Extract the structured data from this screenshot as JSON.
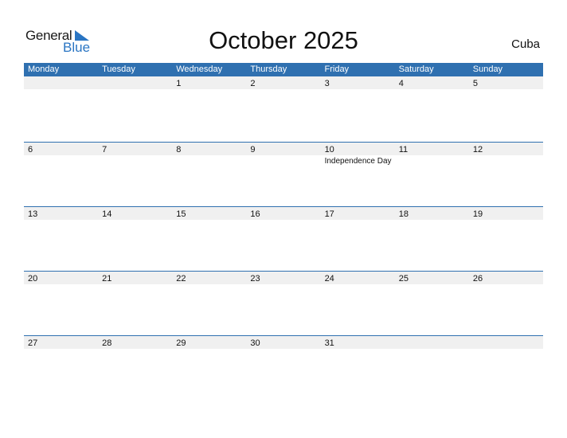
{
  "logo": {
    "word1": "General",
    "word2": "Blue"
  },
  "title": "October 2025",
  "country": "Cuba",
  "colors": {
    "header_bg": "#2f70b0",
    "accent": "#2a75c3",
    "strip_bg": "#f0f0f0"
  },
  "weekdays": [
    "Monday",
    "Tuesday",
    "Wednesday",
    "Thursday",
    "Friday",
    "Saturday",
    "Sunday"
  ],
  "weeks": [
    {
      "days": [
        {
          "n": ""
        },
        {
          "n": ""
        },
        {
          "n": "1"
        },
        {
          "n": "2"
        },
        {
          "n": "3"
        },
        {
          "n": "4"
        },
        {
          "n": "5"
        }
      ]
    },
    {
      "days": [
        {
          "n": "6"
        },
        {
          "n": "7"
        },
        {
          "n": "8"
        },
        {
          "n": "9"
        },
        {
          "n": "10",
          "holiday": "Independence Day"
        },
        {
          "n": "11"
        },
        {
          "n": "12"
        }
      ]
    },
    {
      "days": [
        {
          "n": "13"
        },
        {
          "n": "14"
        },
        {
          "n": "15"
        },
        {
          "n": "16"
        },
        {
          "n": "17"
        },
        {
          "n": "18"
        },
        {
          "n": "19"
        }
      ]
    },
    {
      "days": [
        {
          "n": "20"
        },
        {
          "n": "21"
        },
        {
          "n": "22"
        },
        {
          "n": "23"
        },
        {
          "n": "24"
        },
        {
          "n": "25"
        },
        {
          "n": "26"
        }
      ]
    },
    {
      "days": [
        {
          "n": "27"
        },
        {
          "n": "28"
        },
        {
          "n": "29"
        },
        {
          "n": "30"
        },
        {
          "n": "31"
        },
        {
          "n": ""
        },
        {
          "n": ""
        }
      ]
    }
  ]
}
